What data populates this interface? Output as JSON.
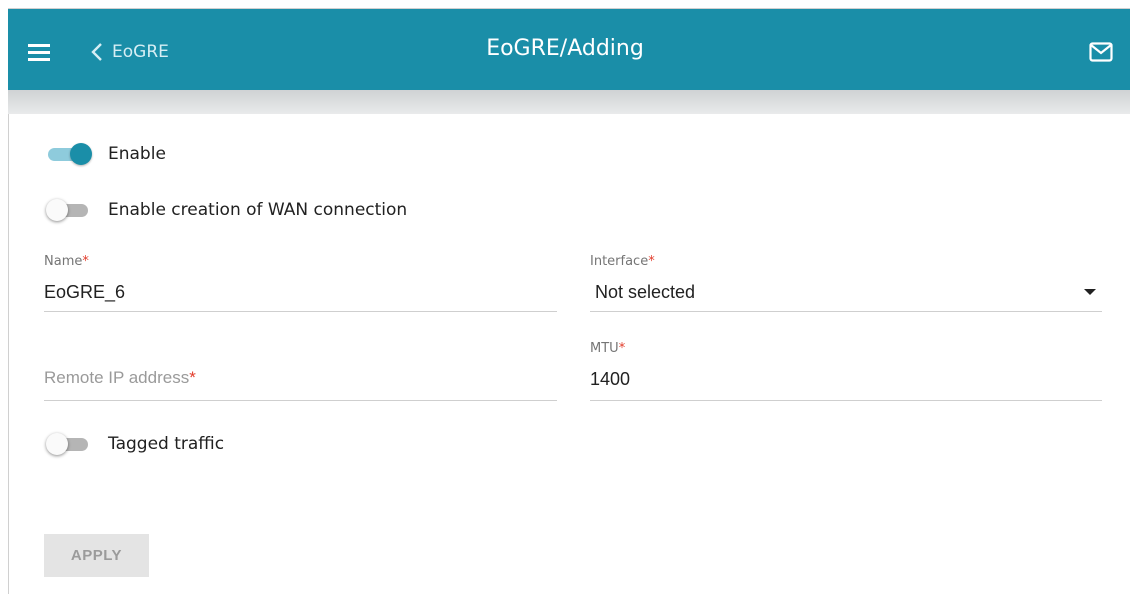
{
  "header": {
    "back_label": "EoGRE",
    "title": "EoGRE/Adding",
    "color": "#1a8ea8"
  },
  "icons": {
    "menu": "menu-icon",
    "back": "chevron-left-icon",
    "mail": "mail-icon"
  },
  "form": {
    "enable": {
      "label": "Enable",
      "on": true
    },
    "wan_creation": {
      "label": "Enable creation of WAN connection",
      "on": false
    },
    "name": {
      "label": "Name",
      "required_mark": "*",
      "value": "EoGRE_6"
    },
    "interface": {
      "label": "Interface",
      "required_mark": "*",
      "value": "Not selected"
    },
    "remote_ip": {
      "placeholder": "Remote IP address",
      "required_mark": "*",
      "value": ""
    },
    "mtu": {
      "label": "MTU",
      "required_mark": "*",
      "value": "1400"
    },
    "tagged_traffic": {
      "label": "Tagged traffic",
      "on": false
    },
    "apply_label": "APPLY"
  }
}
